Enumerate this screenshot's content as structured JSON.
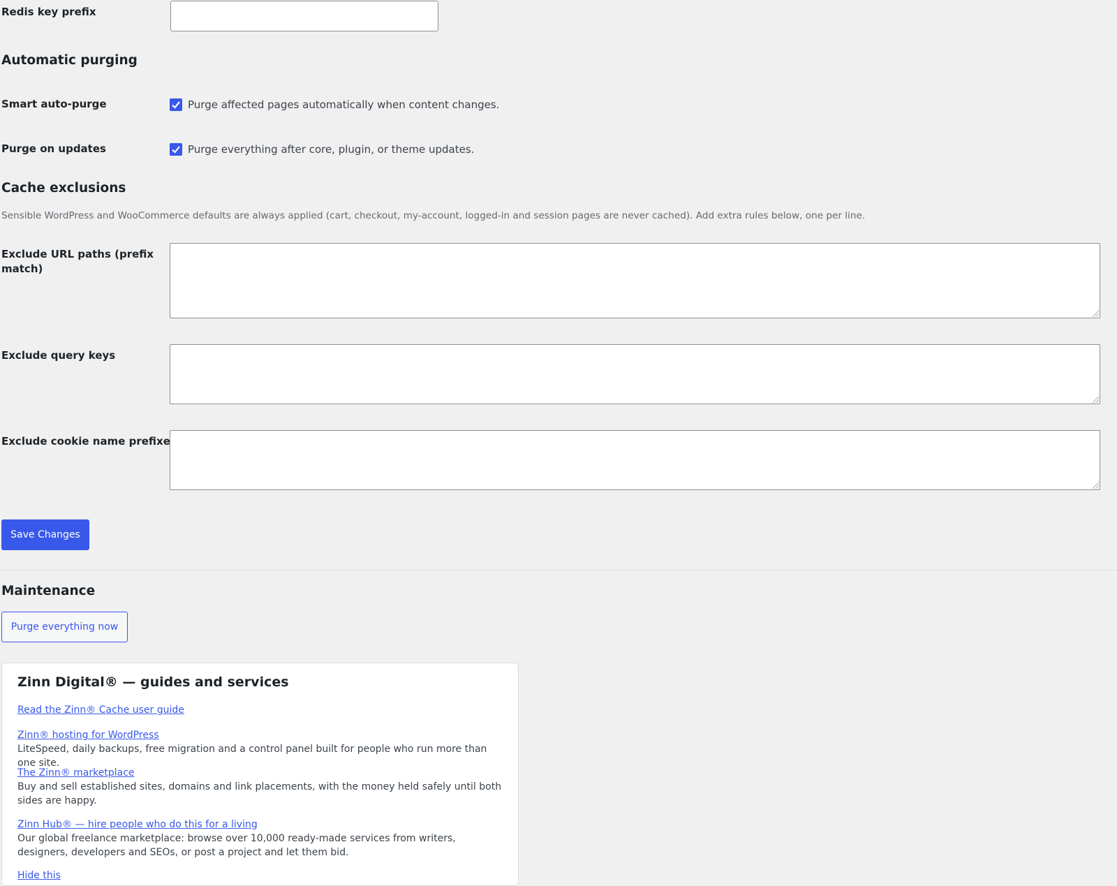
{
  "settings": {
    "redis_prefix": {
      "label": "Redis key prefix",
      "value": ""
    },
    "auto_purging": {
      "heading": "Automatic purging",
      "smart": {
        "label": "Smart auto-purge",
        "text": "Purge affected pages automatically when content changes.",
        "checked": true
      },
      "updates": {
        "label": "Purge on updates",
        "text": "Purge everything after core, plugin, or theme updates.",
        "checked": true
      }
    },
    "exclusions": {
      "heading": "Cache exclusions",
      "description": "Sensible WordPress and WooCommerce defaults are always applied (cart, checkout, my-account, logged-in and session pages are never cached). Add extra rules below, one per line.",
      "url_paths": {
        "label_line1": "Exclude URL paths (prefix",
        "label_line2": "match)",
        "value": ""
      },
      "query_keys": {
        "label": "Exclude query keys",
        "value": ""
      },
      "cookie_prefixes": {
        "label": "Exclude cookie name prefixes",
        "value": ""
      }
    },
    "save_label": "Save Changes"
  },
  "maintenance": {
    "heading": "Maintenance",
    "purge_label": "Purge everything now"
  },
  "card": {
    "title": "Zinn Digital® — guides and services",
    "links": [
      {
        "text": "Read the Zinn® Cache user guide",
        "desc": ""
      },
      {
        "text": "Zinn® hosting for WordPress",
        "desc": "LiteSpeed, daily backups, free migration and a control panel built for people who run more than one site."
      },
      {
        "text": "The Zinn® marketplace",
        "desc": "Buy and sell established sites, domains and link placements, with the money held safely until both sides are happy."
      },
      {
        "text": "Zinn Hub® — hire people who do this for a living",
        "desc": "Our global freelance marketplace: browse over 10,000 ready-made services from writers, designers, developers and SEOs, or post a project and let them bid."
      }
    ],
    "hide_label": "Hide this"
  },
  "colors": {
    "accent": "#3858e9",
    "background": "#f0f0f1"
  }
}
